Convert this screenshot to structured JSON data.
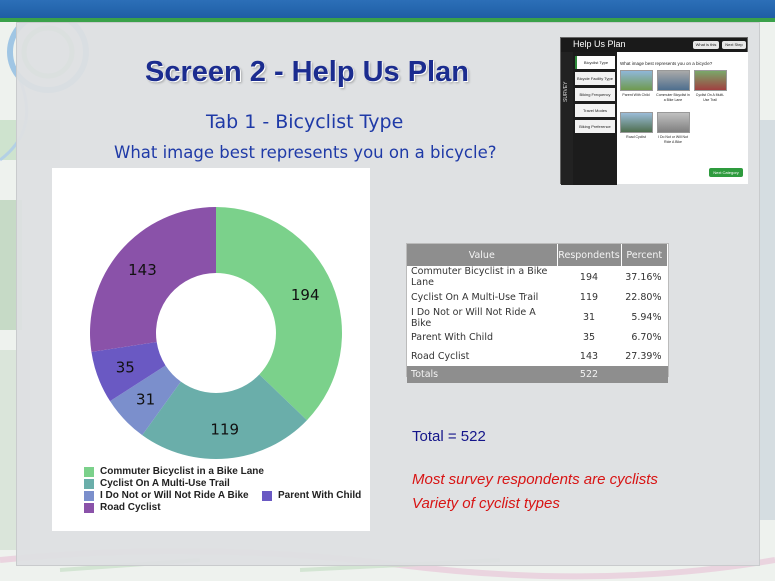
{
  "slide": {
    "title": "Screen 2 - Help Us Plan",
    "subtitle": "Tab 1 - Bicyclist Type",
    "question": "What image best represents you on a bicycle?",
    "total_text": "Total = 522",
    "notes": [
      "Most survey respondents are cyclists",
      "Variety of cyclist types"
    ]
  },
  "chart_data": {
    "type": "pie",
    "title": "",
    "categories": [
      "Commuter Bicyclist in a Bike Lane",
      "Cyclist On A Multi-Use Trail",
      "I Do Not or Will Not Ride A Bike",
      "Parent With Child",
      "Road Cyclist"
    ],
    "values": [
      194,
      119,
      31,
      35,
      143
    ],
    "colors": [
      "#7bd18b",
      "#6aaeaa",
      "#7b8fcc",
      "#6a59c3",
      "#8a52a9"
    ],
    "donut": true,
    "legend_position": "bottom"
  },
  "legend_labels": [
    "Commuter Bicyclist in a Bike Lane",
    "Cyclist On A Multi-Use Trail",
    "I Do Not or Will Not Ride A Bike",
    "Parent With Child",
    "Road Cyclist"
  ],
  "table": {
    "headers": [
      "Value",
      "Respondents",
      "Percent"
    ],
    "rows": [
      [
        "Commuter Bicyclist in a Bike Lane",
        "194",
        "37.16%"
      ],
      [
        "Cyclist On A Multi-Use Trail",
        "119",
        "22.80%"
      ],
      [
        "I Do Not or Will Not Ride A Bike",
        "31",
        "5.94%"
      ],
      [
        "Parent With Child",
        "35",
        "6.70%"
      ],
      [
        "Road Cyclist",
        "143",
        "27.39%"
      ]
    ],
    "totals": [
      "Totals",
      "522",
      ""
    ]
  },
  "thumbnail": {
    "title": "Help Us Plan",
    "buttons": [
      "What is this",
      "Next Step"
    ],
    "side_label": "SURVEY",
    "tabs": [
      "Bicyclist Type",
      "Bicycle Facility Type",
      "Biking Frequency",
      "Travel Modes",
      "Biking Preference"
    ],
    "question": "What image best represents you on a bicycle?",
    "captions": [
      "Parent With Child",
      "Commuter Bicyclist in a Bike Lane",
      "Cyclist On A Multi-Use Trail",
      "Road Cyclist",
      "I Do Not or Will Not Ride A Bike"
    ],
    "next_button": "Next Category"
  },
  "colors": {
    "title": "#1b2c8f",
    "subtitle": "#1f3aa7",
    "note": "#d81414",
    "table_header": "#8e8e8e"
  }
}
